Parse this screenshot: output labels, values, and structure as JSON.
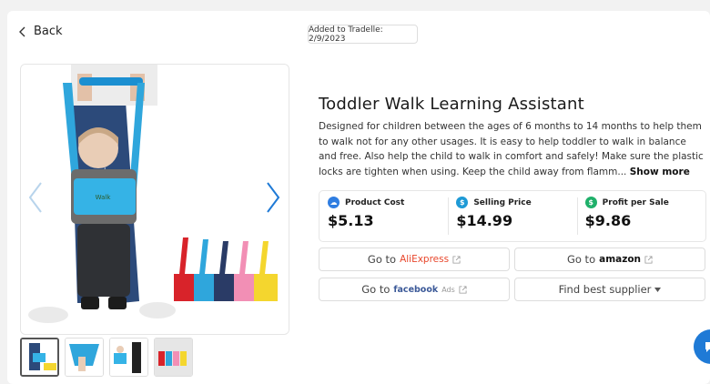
{
  "header": {
    "back_label": "Back",
    "added_date": "Added to Tradelle: 2/9/2023"
  },
  "product": {
    "title": "Toddler Walk Learning Assistant",
    "description": "Designed for children between the ages of 6 months to 14 months to help them to walk not for any other usages. It is easy to help toddler to walk in balance and free. Also help the child to walk in comfort and safely! Make sure the plastic locks are tighten when using. Keep the child away from flamm...",
    "show_more": "Show more"
  },
  "metrics": [
    {
      "label": "Product Cost",
      "value": "$5.13",
      "icon": "product-cost-icon",
      "color": "#2f7de1"
    },
    {
      "label": "Selling Price",
      "value": "$14.99",
      "icon": "price-tag-icon",
      "color": "#1e9ad6"
    },
    {
      "label": "Profit per Sale",
      "value": "$9.86",
      "icon": "money-bag-icon",
      "color": "#1fb06a"
    }
  ],
  "actions": {
    "aliexpress": {
      "prefix": "Go to",
      "brand": "AliExpress"
    },
    "amazon": {
      "prefix": "Go to",
      "brand": "amazon"
    },
    "facebook": {
      "prefix": "Go to",
      "brand": "facebook",
      "suffix": "Ads"
    },
    "supplier": {
      "label": "Find best supplier"
    }
  },
  "colors": {
    "accent_blue": "#1f7ad6",
    "aliexpress_red": "#e8462b",
    "facebook_blue": "#3b5998"
  }
}
